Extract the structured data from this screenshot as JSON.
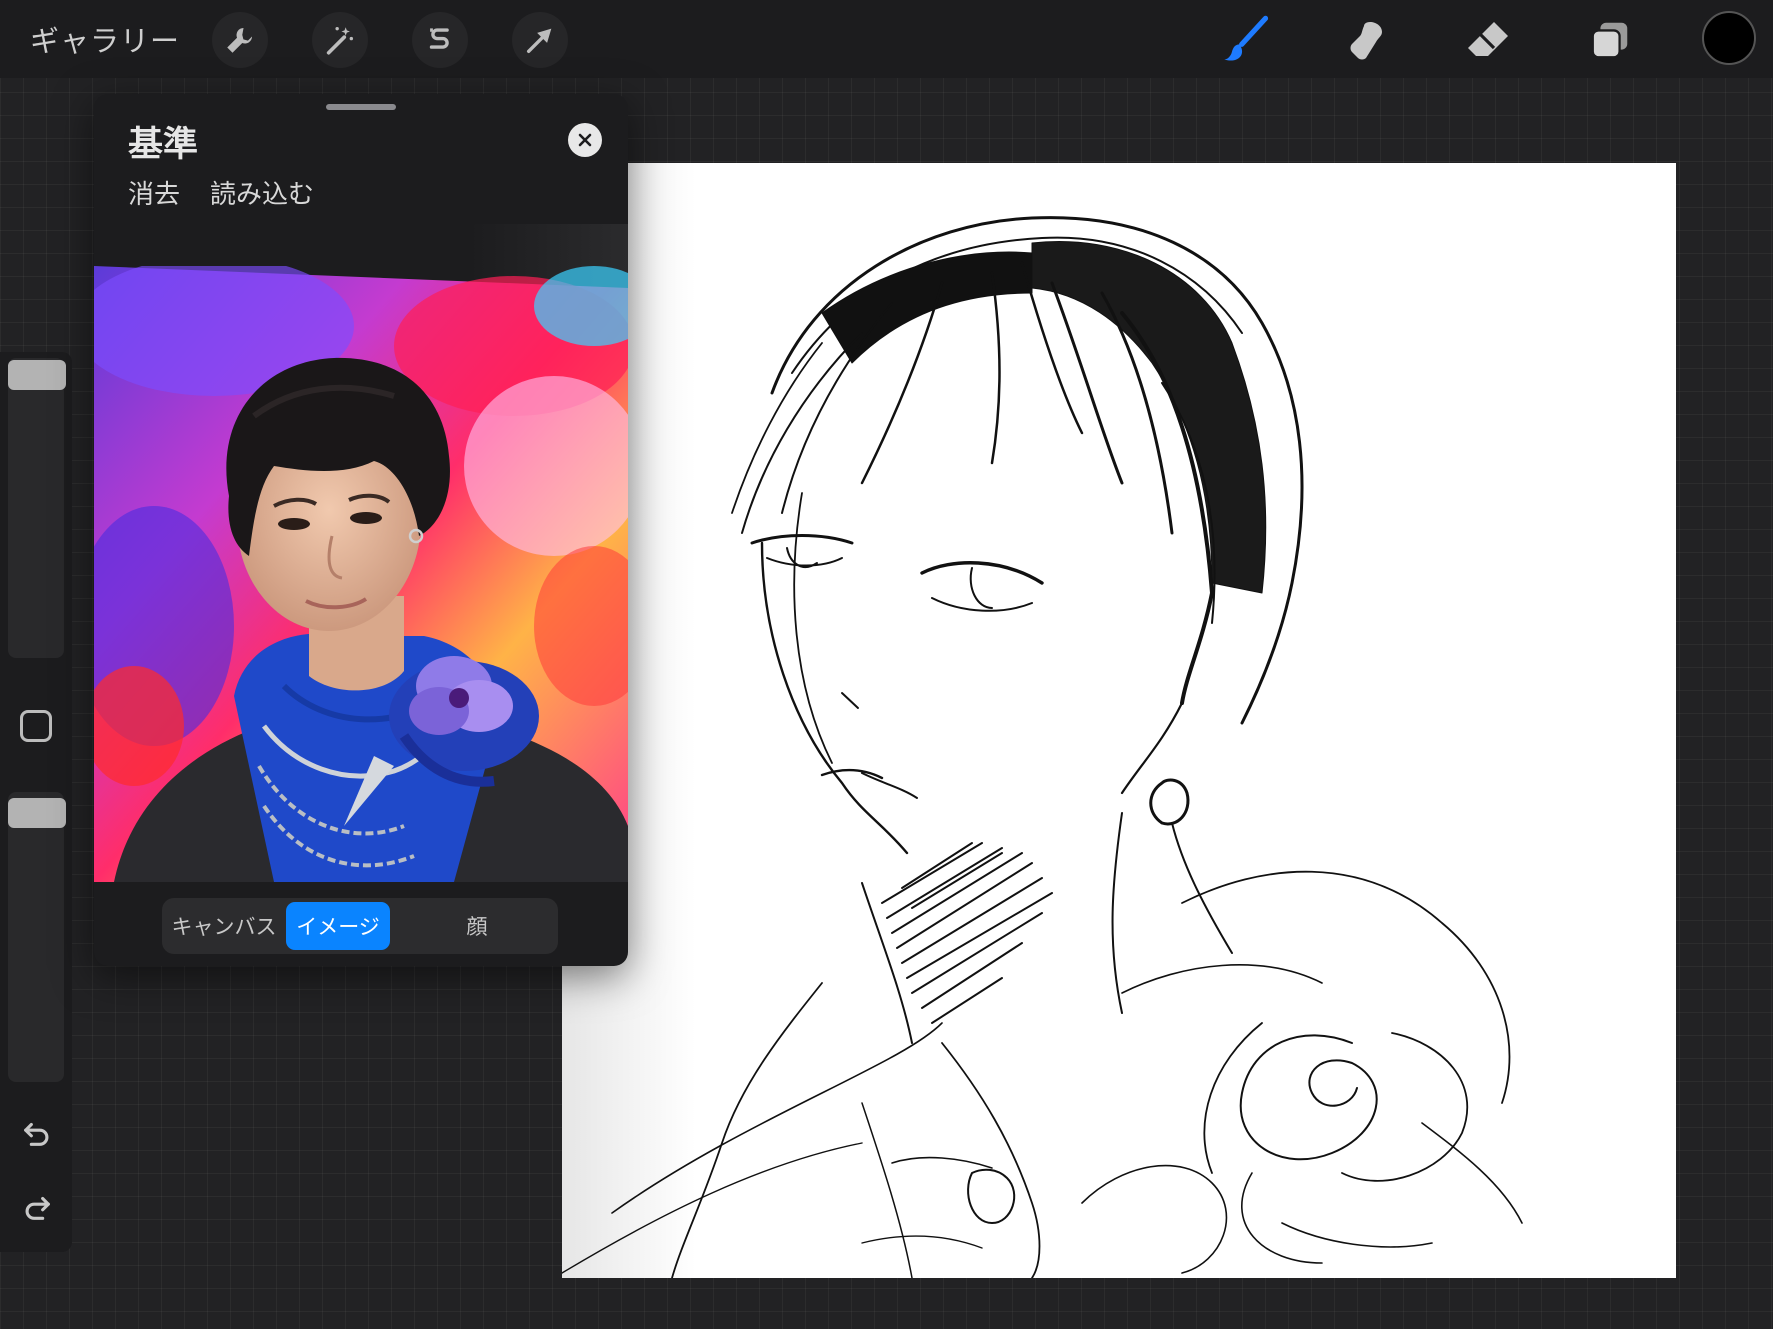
{
  "toolbar": {
    "gallery_label": "ギャラリー",
    "left_tools": [
      "wrench-icon",
      "magic-wand-icon",
      "selection-s-icon",
      "transform-arrow-icon"
    ],
    "right_tools": [
      "brush-icon",
      "smudge-icon",
      "eraser-icon",
      "layers-icon"
    ],
    "active_tool": "brush",
    "accent_color": "#1e7bff",
    "current_color": "#000000"
  },
  "reference_panel": {
    "title": "基準",
    "clear_label": "消去",
    "import_label": "読み込む",
    "modes": [
      "キャンバス",
      "イメージ",
      "顔"
    ],
    "active_mode": "イメージ"
  },
  "sidebar": {
    "brush_size_level": 0.06,
    "opacity_level": 0.95
  }
}
